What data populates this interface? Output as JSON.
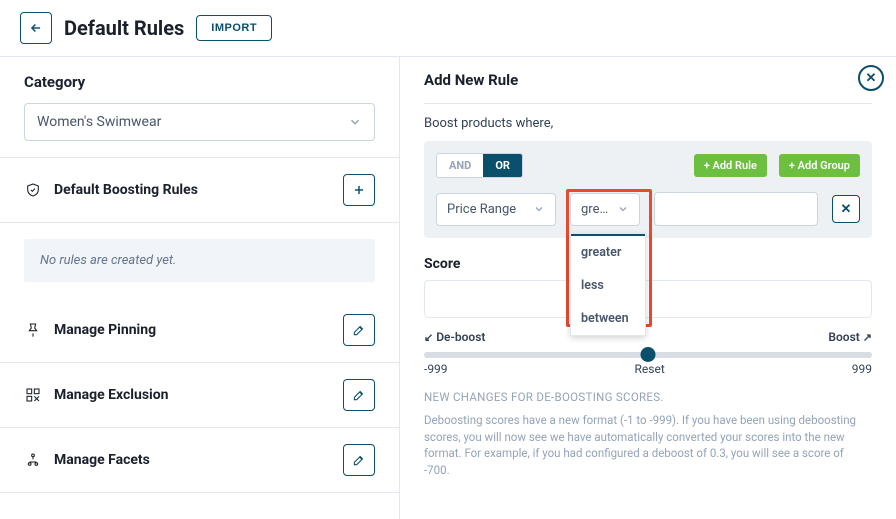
{
  "header": {
    "title": "Default Rules",
    "import_label": "IMPORT"
  },
  "left": {
    "category_heading": "Category",
    "category_value": "Women's Swimwear",
    "boosting_heading": "Default Boosting Rules",
    "no_rules_text": "No rules are created yet.",
    "rows": [
      {
        "label": "Manage Pinning"
      },
      {
        "label": "Manage Exclusion"
      },
      {
        "label": "Manage Facets"
      }
    ]
  },
  "right": {
    "title": "Add New Rule",
    "subtext": "Boost products where,",
    "logic": {
      "and": "AND",
      "or": "OR",
      "active": "OR"
    },
    "add_rule": "+ Add Rule",
    "add_group": "+ Add Group",
    "field_select": "Price Range",
    "operator_select": "grea...",
    "operator_options": [
      "greater",
      "less",
      "between"
    ],
    "score_heading": "Score",
    "slider": {
      "left_label": "De-boost",
      "right_label": "Boost",
      "min": "-999",
      "reset": "Reset",
      "max": "999"
    },
    "note_heading": "NEW CHANGES FOR DE-BOOSTING SCORES.",
    "note_body": "Deboosting scores have a new format (-1 to -999). If you have been using deboosting scores, you will now see we have automatically converted your scores into the new format. For example, if you had configured a deboost of 0.3, you will see a score of -700."
  },
  "chart_data": {
    "type": "bar",
    "categories": [],
    "values": [],
    "title": "",
    "xlabel": "",
    "ylabel": "",
    "ylim": [
      0,
      0
    ]
  }
}
